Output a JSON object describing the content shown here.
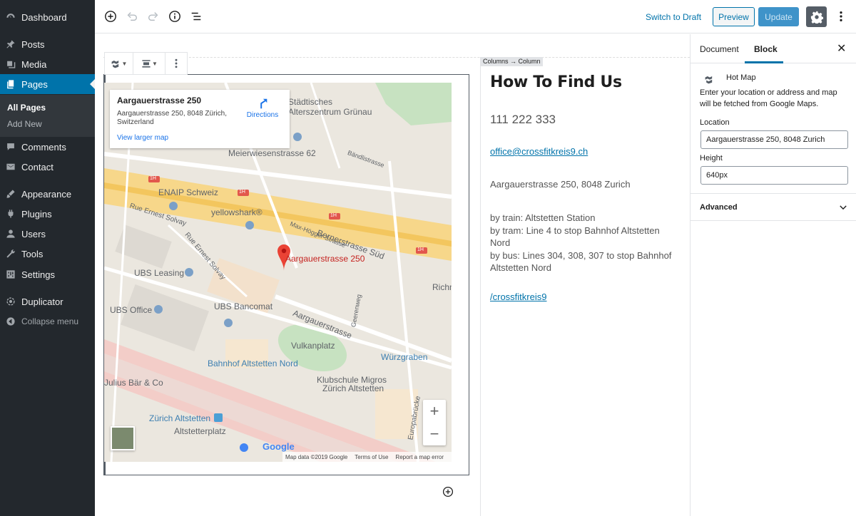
{
  "admin_menu": {
    "items": [
      {
        "label": "Dashboard"
      },
      {
        "label": "Posts"
      },
      {
        "label": "Media"
      },
      {
        "label": "Pages"
      },
      {
        "label": "Comments"
      },
      {
        "label": "Contact"
      },
      {
        "label": "Appearance"
      },
      {
        "label": "Plugins"
      },
      {
        "label": "Users"
      },
      {
        "label": "Tools"
      },
      {
        "label": "Settings"
      },
      {
        "label": "Duplicator"
      }
    ],
    "submenu": [
      "All Pages",
      "Add New"
    ],
    "collapse_label": "Collapse menu",
    "active_color": "#0073aa"
  },
  "toolbar": {
    "switch_draft": "Switch to Draft",
    "preview": "Preview",
    "update": "Update"
  },
  "block_toolbar": {
    "icons": [
      "map-icon",
      "align-center-icon",
      "more-options-icon"
    ]
  },
  "map": {
    "info_title": "Aargauerstrasse 250",
    "info_address": "Aargauerstrasse 250, 8048 Zürich, Switzerland",
    "directions": "Directions",
    "view_larger": "View larger map",
    "pin_label": "Aargauerstrasse 250",
    "labels": {
      "staedtisches": "Städtisches",
      "alterszentrum": "Alterszentrum Grünau",
      "meierwiesen": "Meierwiesenstrasse 62",
      "baendli": "Bändlistrasse",
      "enaip": "ENAIP Schweiz",
      "rue_ernest": "Rue Ernest Solvay",
      "yellowshark": "yellowshark®",
      "max_hoegger": "Max-Högger-Strasse",
      "bernerstrasse": "Bernerstrasse Süd",
      "ubs_leasing": "UBS Leasing",
      "rue_ernest2": "Rue Ernest Solvay",
      "richn": "Richn",
      "ubs_office": "UBS Office",
      "ubs_bancomat": "UBS Bancomat",
      "geerenweg": "Geerenweg",
      "aargauerstrasse": "Aargauerstrasse",
      "vulkanplatz": "Vulkanplatz",
      "wuerzgraben": "Würzgraben",
      "bahnhof_nord": "Bahnhof Altstetten Nord",
      "julius": "Julius Bär & Co",
      "klubschule1": "Klubschule Migros",
      "klubschule2": "Zürich Altstetten",
      "europabruecke": "Europabrücke",
      "zuerich_altstetten": "Zürich Altstetten",
      "altstetterplatz": "Altstetterplatz",
      "hw1": "1H",
      "hw2": "1H",
      "hw3": "1H",
      "hw4": "1H"
    },
    "google": "Google",
    "map_data": "Map data ©2019 Google",
    "terms": "Terms of Use",
    "report": "Report a map error"
  },
  "column": {
    "breadcrumb": "Columns → Column",
    "heading": "How To Find Us",
    "phone": "111 222 333",
    "email": "office@crossfitkreis9.ch",
    "address": "Aargauerstrasse 250, 8048 Zurich",
    "transport": [
      "by train: Altstetten Station",
      "by tram: Line 4 to stop Bahnhof Altstetten Nord",
      "by bus: Lines 304, 308, 307 to stop Bahnhof Altstetten Nord"
    ],
    "social": "/crossfitkreis9"
  },
  "settings_panel": {
    "tab_document": "Document",
    "tab_block": "Block",
    "block_name": "Hot Map",
    "block_description": "Enter your location or address and map will be fetched from Google Maps.",
    "location_label": "Location",
    "location_value": "Aargauerstrasse 250, 8048 Zurich",
    "height_label": "Height",
    "height_value": "640px",
    "advanced_label": "Advanced"
  }
}
